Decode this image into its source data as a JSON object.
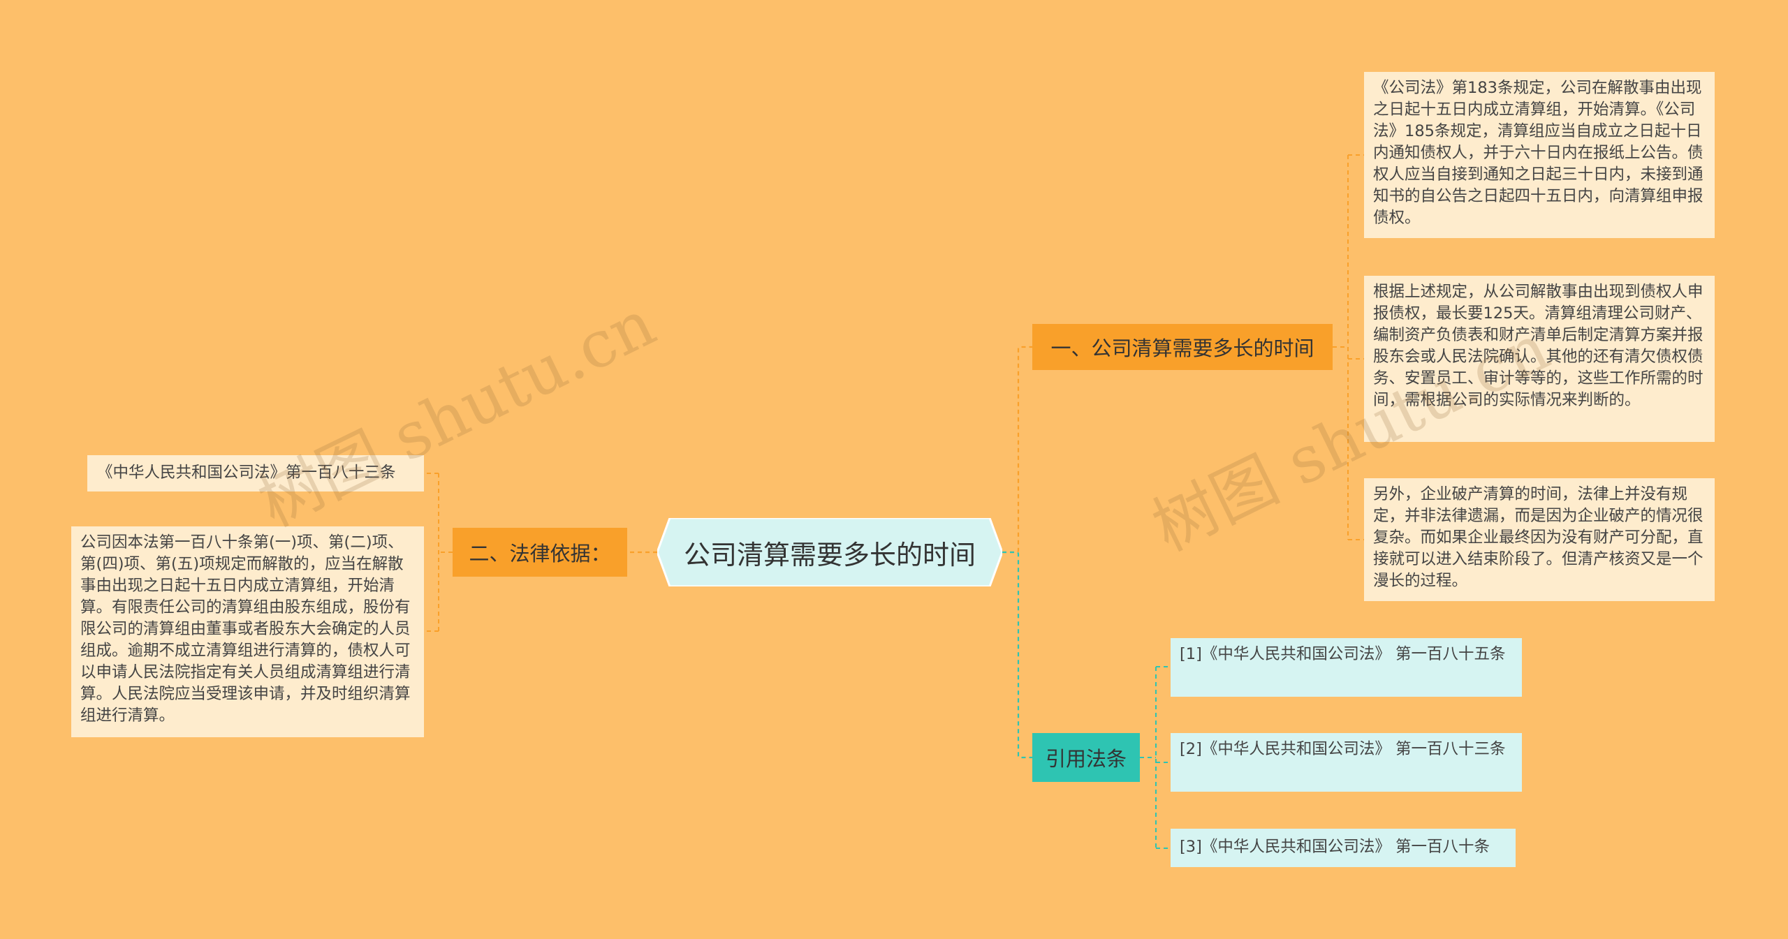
{
  "root": {
    "label": "公司清算需要多长的时间"
  },
  "branches": {
    "time": {
      "label": "一、公司清算需要多长的时间",
      "leaves": [
        "《公司法》第183条规定，公司在解散事由出现之日起十五日内成立清算组，开始清算。《公司法》185条规定，清算组应当自成立之日起十日内通知债权人，并于六十日内在报纸上公告。债权人应当自接到通知之日起三十日内，未接到通知书的自公告之日起四十五日内，向清算组申报债权。",
        "根据上述规定，从公司解散事由出现到债权人申报债权，最长要125天。清算组清理公司财产、编制资产负债表和财产清单后制定清算方案并报股东会或人民法院确认。其他的还有清欠债权债务、安置员工、审计等等的，这些工作所需的时间，需根据公司的实际情况来判断的。",
        "另外，企业破产清算的时间，法律上并没有规定，并非法律遗漏，而是因为企业破产的情况很复杂。而如果企业最终因为没有财产可分配，直接就可以进入结束阶段了。但清产核资又是一个漫长的过程。"
      ]
    },
    "basis": {
      "label": "二、法律依据：",
      "leaves": [
        "《中华人民共和国公司法》第一百八十三条",
        "公司因本法第一百八十条第(一)项、第(二)项、第(四)项、第(五)项规定而解散的，应当在解散事由出现之日起十五日内成立清算组，开始清算。有限责任公司的清算组由股东组成，股份有限公司的清算组由董事或者股东大会确定的人员组成。逾期不成立清算组进行清算的，债权人可以申请人民法院指定有关人员组成清算组进行清算。人民法院应当受理该申请，并及时组织清算组进行清算。"
      ]
    },
    "refs": {
      "label": "引用法条",
      "leaves": [
        "[1]《中华人民共和国公司法》 第一百八十五条",
        "[2]《中华人民共和国公司法》 第一百八十三条",
        "[3]《中华人民共和国公司法》 第一百八十条"
      ]
    }
  },
  "colors": {
    "background": "#fdbf6a",
    "root_fill": "#d6f4f2",
    "orange_branch": "#f9a02a",
    "teal_branch": "#2ec4b2",
    "cream_leaf": "#feeccd",
    "aqua_leaf": "#d6f4f2"
  },
  "watermark": "树图 shutu.cn"
}
